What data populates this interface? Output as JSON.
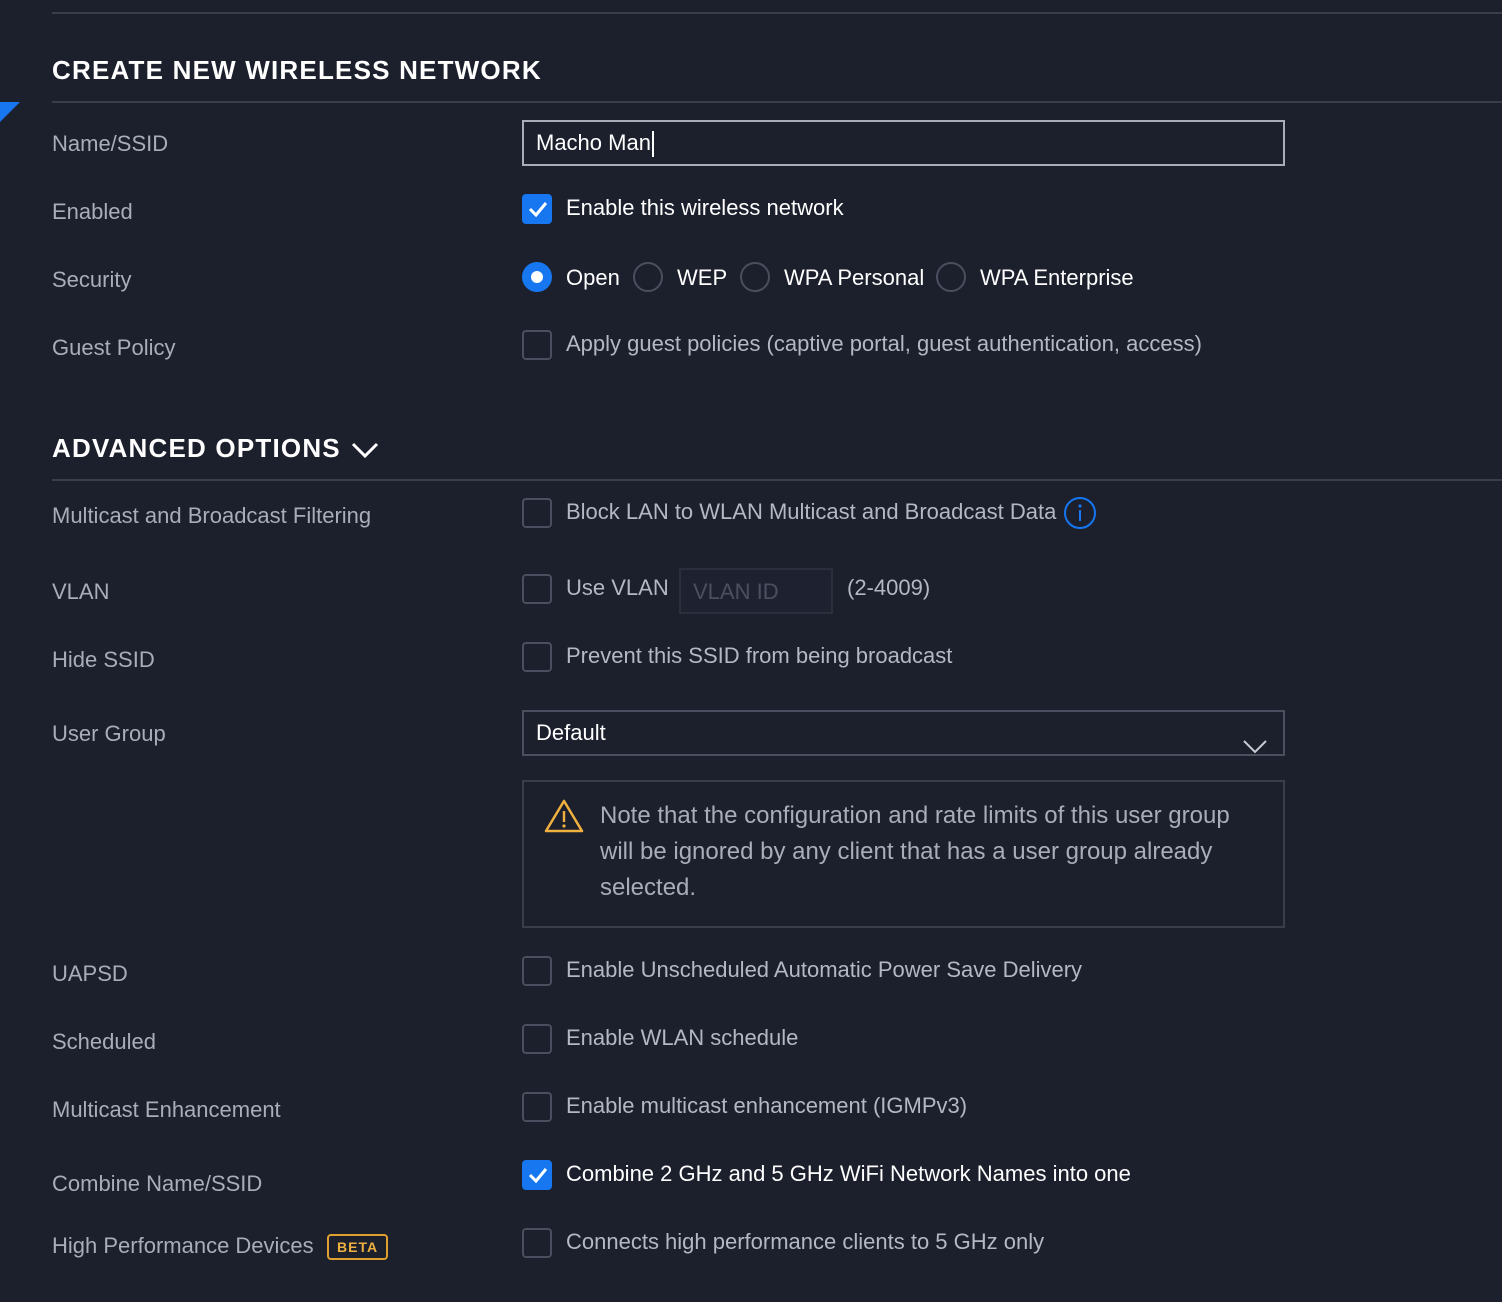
{
  "sections": {
    "create_title": "CREATE NEW WIRELESS NETWORK",
    "advanced_title": "ADVANCED OPTIONS"
  },
  "fields": {
    "name": {
      "label": "Name/SSID",
      "value": "Macho Man"
    },
    "enabled": {
      "label": "Enabled",
      "text": "Enable this wireless network",
      "checked": true
    },
    "security": {
      "label": "Security",
      "options": [
        "Open",
        "WEP",
        "WPA Personal",
        "WPA Enterprise"
      ],
      "selected": "Open"
    },
    "guest_policy": {
      "label": "Guest Policy",
      "text": "Apply guest policies (captive portal, guest authentication, access)",
      "checked": false
    },
    "multicast_filtering": {
      "label": "Multicast and Broadcast Filtering",
      "text": "Block LAN to WLAN Multicast and Broadcast Data",
      "checked": false
    },
    "vlan": {
      "label": "VLAN",
      "text": "Use VLAN",
      "placeholder": "VLAN ID",
      "range": "(2-4009)",
      "checked": false
    },
    "hide_ssid": {
      "label": "Hide SSID",
      "text": "Prevent this SSID from being broadcast",
      "checked": false
    },
    "user_group": {
      "label": "User Group",
      "value": "Default",
      "note": "Note that the configuration and rate limits of this user group will be ignored by any client that has a user group already selected."
    },
    "uapsd": {
      "label": "UAPSD",
      "text": "Enable Unscheduled Automatic Power Save Delivery",
      "checked": false
    },
    "scheduled": {
      "label": "Scheduled",
      "text": "Enable WLAN schedule",
      "checked": false
    },
    "multicast_enhancement": {
      "label": "Multicast Enhancement",
      "text": "Enable multicast enhancement (IGMPv3)",
      "checked": false
    },
    "combine_ssid": {
      "label": "Combine Name/SSID",
      "text": "Combine 2 GHz and 5 GHz WiFi Network Names into one",
      "checked": true
    },
    "high_performance": {
      "label": "High Performance Devices",
      "badge": "BETA",
      "text": "Connects high performance clients to 5 GHz only",
      "checked": false
    }
  },
  "colors": {
    "accent": "#1677f0",
    "background": "#1c1f2c",
    "warning": "#f0b040"
  },
  "icons": {
    "info": "info-icon",
    "warning": "warning-icon",
    "dropdown": "chevron-down-icon",
    "check": "checkmark-icon"
  }
}
